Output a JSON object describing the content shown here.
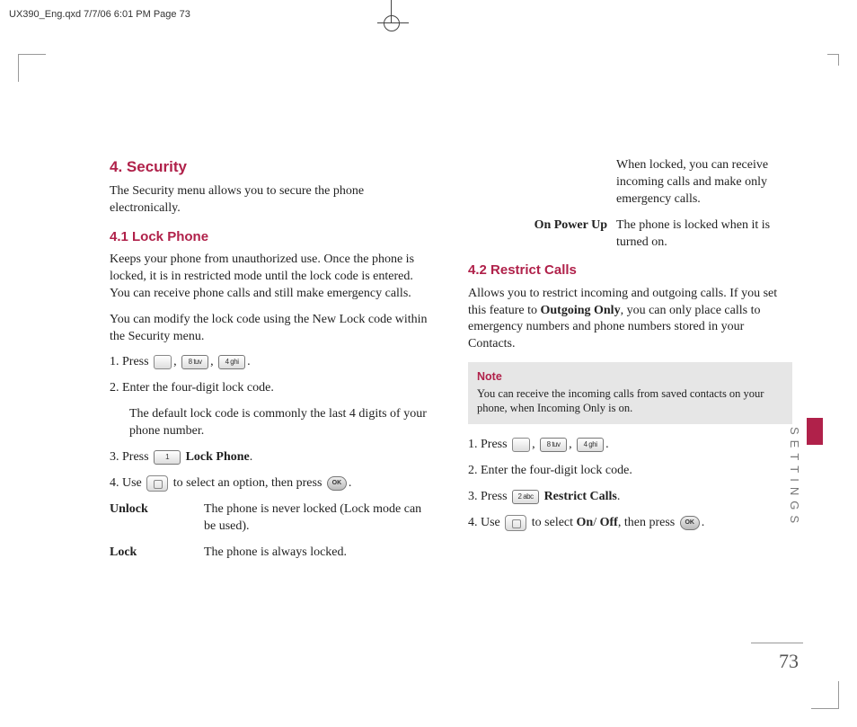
{
  "meta": {
    "header": "UX390_Eng.qxd  7/7/06  6:01 PM  Page 73",
    "page_number": "73",
    "side_label": "SETTINGS"
  },
  "s4": {
    "title": "4. Security",
    "intro": "The Security menu allows you to secure the phone electronically."
  },
  "s41": {
    "title": "4.1 Lock Phone",
    "p1": "Keeps your phone from unauthorized use. Once the phone is locked, it is in restricted mode until the lock code is entered. You can receive phone calls and still make emergency calls.",
    "p2": "You can modify the lock code using the New Lock code within the Security menu.",
    "step1a": "1. Press ",
    "step1b": ", ",
    "step1c": ", ",
    "step1d": ".",
    "step2": "2. Enter the four-digit lock code.",
    "indent": "The default lock code is commonly the last 4 digits of your phone number.",
    "step3a": "3. Press ",
    "step3b": " Lock Phone",
    "step3c": ".",
    "step4a": "4. Use ",
    "step4b": " to select an option, then press ",
    "step4c": ".",
    "def_unlock_t": "Unlock",
    "def_unlock_d": "The phone is never locked (Lock mode can be used).",
    "def_lock_t": "Lock",
    "def_lock_d": "The phone is always locked."
  },
  "s41r": {
    "cont": "When locked, you can receive incoming calls and make only emergency calls.",
    "onpower_t": "On Power Up",
    "onpower_d": "The phone is locked when it is turned on."
  },
  "s42": {
    "title": "4.2 Restrict Calls",
    "p1a": "Allows you to restrict incoming and outgoing calls. If you set this feature to ",
    "p1b": "Outgoing Only",
    "p1c": ", you can only place calls to emergency numbers and phone numbers stored in your Contacts.",
    "note_t": "Note",
    "note_b": "You can receive the incoming calls from saved contacts on your phone, when Incoming Only is on.",
    "step1a": "1. Press ",
    "step1b": ", ",
    "step1c": ", ",
    "step1d": ".",
    "step2": "2. Enter the four-digit lock code.",
    "step3a": "3. Press ",
    "step3b": " Restrict Calls",
    "step3c": ".",
    "step4a": "4. Use ",
    "step4b": " to select ",
    "step4c": "On",
    "step4d": "/ ",
    "step4e": "Off",
    "step4f": ", then press ",
    "step4g": "."
  },
  "keys": {
    "k8": "8 tuv",
    "k4": "4 ghi",
    "k1": "1",
    "k2": "2 abc",
    "ok": "OK"
  }
}
